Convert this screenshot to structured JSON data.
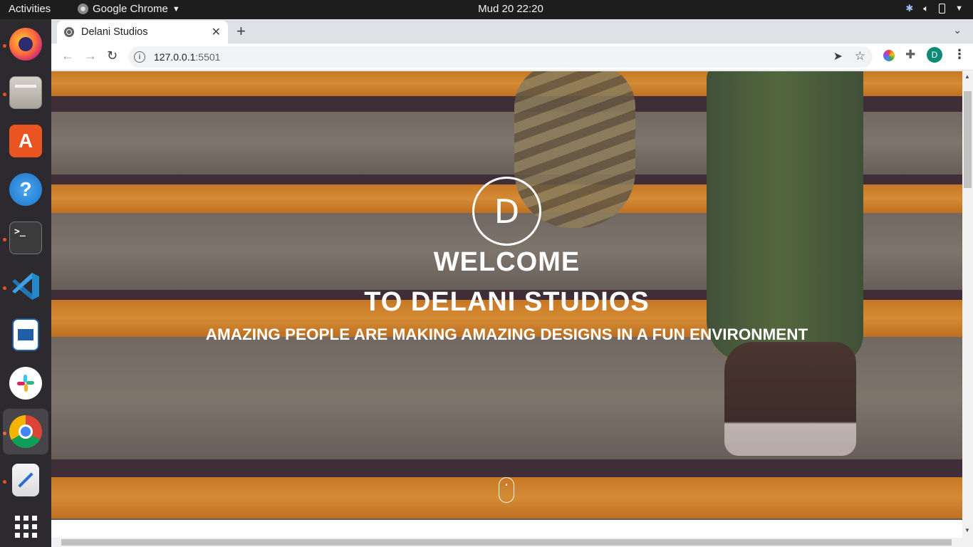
{
  "topbar": {
    "activities": "Activities",
    "app_name": "Google Chrome",
    "clock": "Mud 20  22:20"
  },
  "dock": {
    "items": [
      "Firefox",
      "Files",
      "Ubuntu Software",
      "Help",
      "Terminal",
      "Visual Studio Code",
      "LibreOffice Impress",
      "Slack",
      "Google Chrome",
      "Text Editor",
      "Show Applications"
    ]
  },
  "browser": {
    "tab_title": "Delani Studios",
    "url_host": "127.0.0.1",
    "url_port": ":5501",
    "profile_initial": "D"
  },
  "hero": {
    "logo_letter": "D",
    "heading_line1": "WELCOME",
    "heading_line2": "TO DELANI STUDIOS",
    "tagline": "AMAZING PEOPLE ARE MAKING AMAZING DESIGNS IN A FUN ENVIRONMENT"
  },
  "colors": {
    "accent_orange": "#f3a233",
    "ubuntu_dot": "#e95420",
    "profile_bg": "#0b8a76"
  }
}
